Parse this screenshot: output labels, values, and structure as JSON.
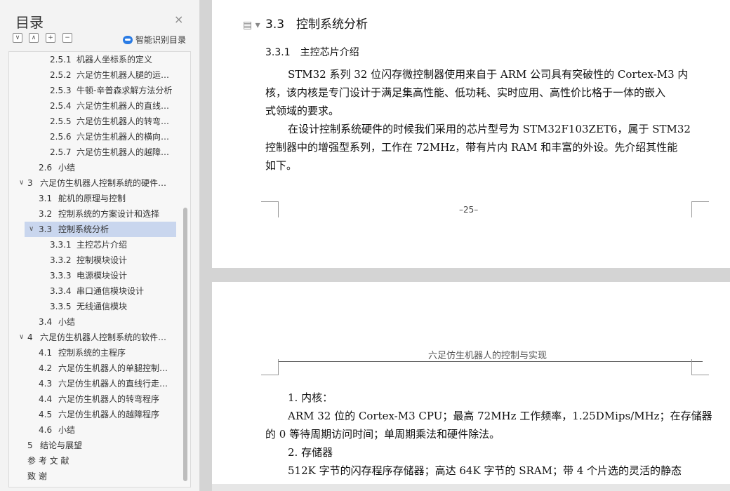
{
  "sidebar": {
    "title": "目录",
    "close_icon": "×",
    "toolbar": [
      "∨",
      "∧",
      "+",
      "−"
    ],
    "smart_label": "智能识别目录",
    "toc": [
      {
        "num": "2.5.1",
        "label": "机器人坐标系的定义",
        "level": 2
      },
      {
        "num": "2.5.2",
        "label": "六足仿生机器人腿的运动学分析",
        "level": 2
      },
      {
        "num": "2.5.3",
        "label": "牛顿-辛普森求解方法分析",
        "level": 2
      },
      {
        "num": "2.5.4",
        "label": "六足仿生机器人的直线行走分析",
        "level": 2
      },
      {
        "num": "2.5.5",
        "label": "六足仿生机器人的转弯分析",
        "level": 2
      },
      {
        "num": "2.5.6",
        "label": "六足仿生机器人的横向行走分析",
        "level": 2
      },
      {
        "num": "2.5.7",
        "label": "六足仿生机器人的越障分析",
        "level": 2
      },
      {
        "num": "2.6",
        "label": "小结",
        "level": 1
      },
      {
        "num": "3",
        "label": "六足仿生机器人控制系统的硬件设计",
        "level": 0,
        "arrow": "∨"
      },
      {
        "num": "3.1",
        "label": "舵机的原理与控制",
        "level": 1
      },
      {
        "num": "3.2",
        "label": "控制系统的方案设计和选择",
        "level": 1
      },
      {
        "num": "3.3",
        "label": "控制系统分析",
        "level": 1,
        "arrow": "∨",
        "selected": true
      },
      {
        "num": "3.3.1",
        "label": "主控芯片介绍",
        "level": 2
      },
      {
        "num": "3.3.2",
        "label": "控制模块设计",
        "level": 2
      },
      {
        "num": "3.3.3",
        "label": "电源模块设计",
        "level": 2
      },
      {
        "num": "3.3.4",
        "label": "串口通信模块设计",
        "level": 2
      },
      {
        "num": "3.3.5",
        "label": "无线通信模块",
        "level": 2
      },
      {
        "num": "3.4",
        "label": "小结",
        "level": 1
      },
      {
        "num": "4",
        "label": "六足仿生机器人控制系统的软件设计",
        "level": 0,
        "arrow": "∨"
      },
      {
        "num": "4.1",
        "label": "控制系统的主程序",
        "level": 1
      },
      {
        "num": "4.2",
        "label": "六足仿生机器人的单腿控制程序",
        "level": 1
      },
      {
        "num": "4.3",
        "label": "六足仿生机器人的直线行走程序",
        "level": 1
      },
      {
        "num": "4.4",
        "label": "六足仿生机器人的转弯程序",
        "level": 1
      },
      {
        "num": "4.5",
        "label": "六足仿生机器人的越障程序",
        "level": 1
      },
      {
        "num": "4.6",
        "label": "小结",
        "level": 1
      },
      {
        "num": "5",
        "label": "结论与展望",
        "level": 0
      },
      {
        "num": "",
        "label": "参 考 文 献",
        "level": 0
      },
      {
        "num": "",
        "label": "致    谢",
        "level": 0
      }
    ]
  },
  "page1": {
    "heading": "3.3　控制系统分析",
    "subheading": "3.3.1　主控芯片介绍",
    "lines": [
      "STM32 系列 32 位闪存微控制器使用来自于 ARM 公司具有突破性的 Cortex-M3 内",
      "核，该内核是专门设计于满足集高性能、低功耗、实时应用、高性价比格于一体的嵌入",
      "式领域的要求。",
      "在设计控制系统硬件的时候我们采用的芯片型号为 STM32F103ZET6，属于 STM32",
      "控制器中的增强型系列，工作在 72MHz，带有片内 RAM 和丰富的外设。先介绍其性能",
      "如下。"
    ],
    "page_number": "–25–"
  },
  "page2": {
    "header": "六足仿生机器人的控制与实现",
    "lines": [
      "1.  内核：",
      "ARM 32 位的 Cortex-M3 CPU；最高 72MHz 工作频率，1.25DMips/MHz；在存储器",
      "的 0 等待周期访问时间；单周期乘法和硬件除法。",
      "2.  存储器",
      "512K 字节的闪存程序存储器；高达 64K 字节的 SRAM；带 4 个片选的灵活的静态"
    ]
  }
}
